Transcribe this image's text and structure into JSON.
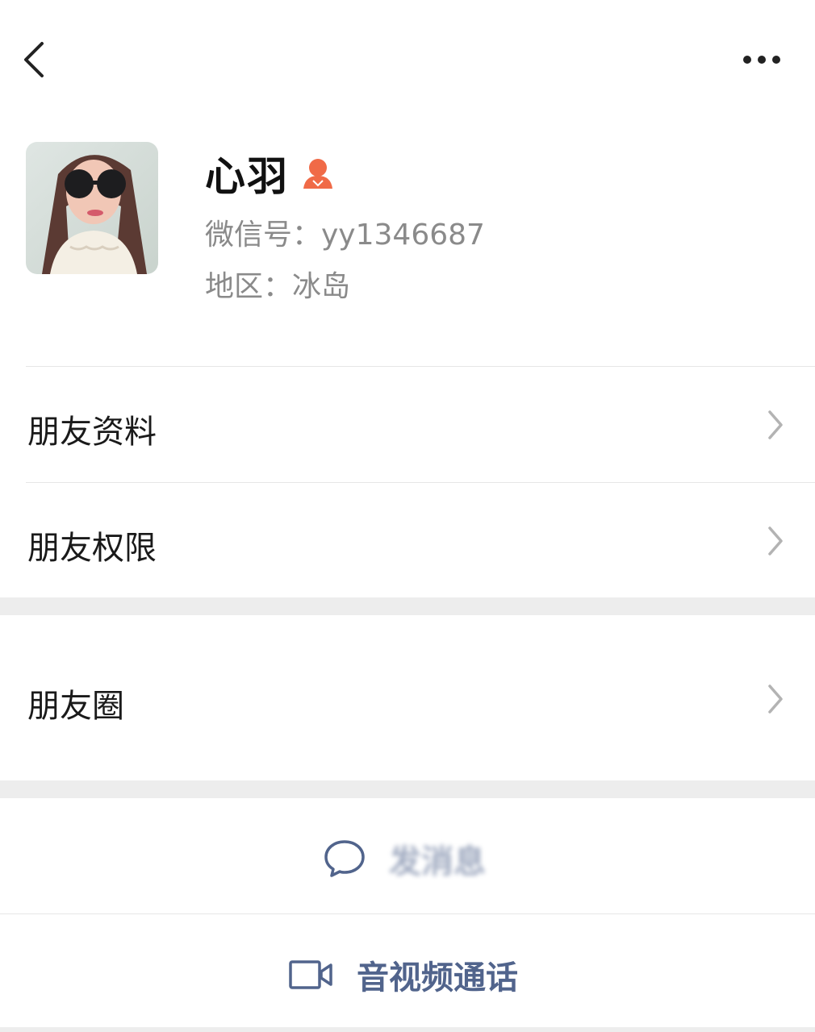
{
  "topbar": {
    "back_icon": "chevron-left-icon",
    "more_icon": "more-dots-icon"
  },
  "profile": {
    "name": "心羽",
    "gender_icon": "female-user-icon",
    "gender_color": "#f06a47",
    "wechat_id": "微信号：yy1346687",
    "region": "地区：冰岛"
  },
  "menu": {
    "items": [
      {
        "label": "朋友资料"
      },
      {
        "label": "朋友权限"
      },
      {
        "label": "朋友圈"
      }
    ]
  },
  "actions": {
    "message": {
      "label": "发消息",
      "icon": "chat-bubble-icon"
    },
    "call": {
      "label": "音视频通话",
      "icon": "video-camera-icon"
    }
  },
  "colors": {
    "action_blue": "#51648c",
    "separator": "#ededed"
  }
}
